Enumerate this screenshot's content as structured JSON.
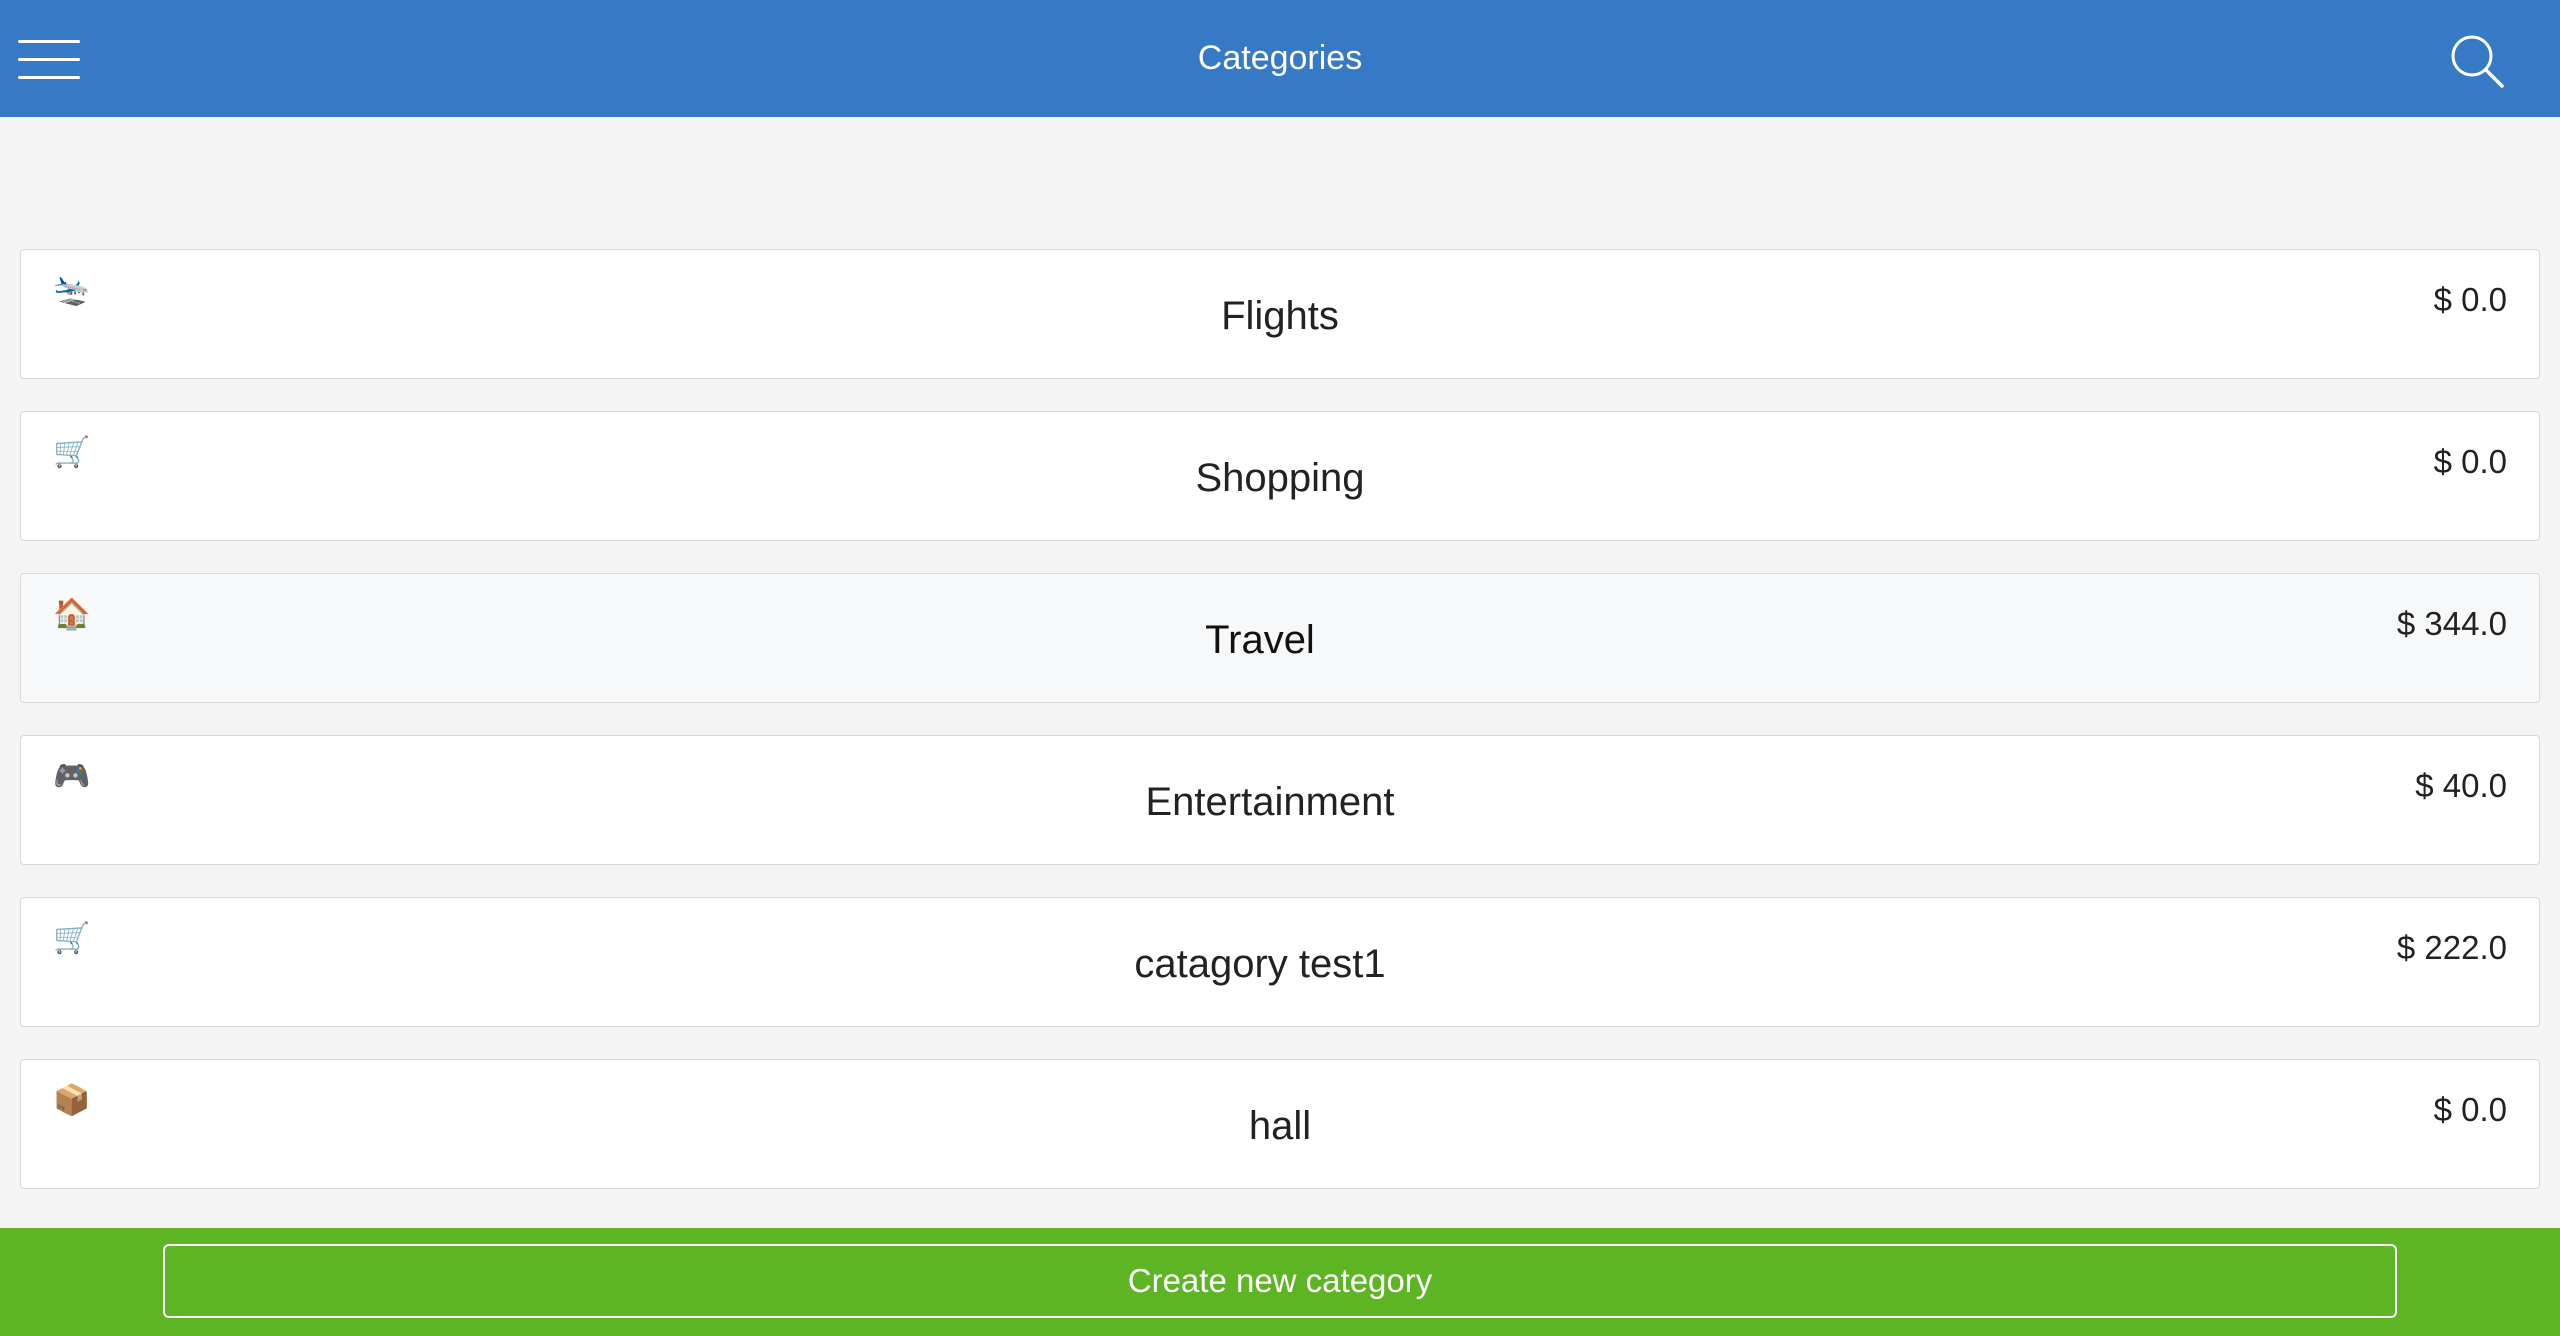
{
  "header": {
    "title": "Categories",
    "menu_icon": "hamburger-menu-icon",
    "search_icon": "search-icon",
    "background_color": "#3679c5"
  },
  "categories": [
    {
      "icon": "🛬",
      "icon_name": "airplane-icon",
      "name": "Flights",
      "amount": "$ 0.0"
    },
    {
      "icon": "🛒",
      "icon_name": "shopping-cart-icon",
      "name": "Shopping",
      "amount": "$ 0.0"
    },
    {
      "icon": "🏠",
      "icon_name": "house-icon",
      "name": "Travel",
      "amount": "$ 344.0"
    },
    {
      "icon": "🎮",
      "icon_name": "game-controller-icon",
      "name": "Entertainment",
      "amount": "$ 40.0"
    },
    {
      "icon": "🛒",
      "icon_name": "shopping-cart-icon",
      "name": "catagory test1",
      "amount": "$ 222.0"
    },
    {
      "icon": "📦",
      "icon_name": "package-icon",
      "name": "hall",
      "amount": "$ 0.0"
    }
  ],
  "footer": {
    "create_label": "Create new category",
    "background_color": "#5db523"
  }
}
